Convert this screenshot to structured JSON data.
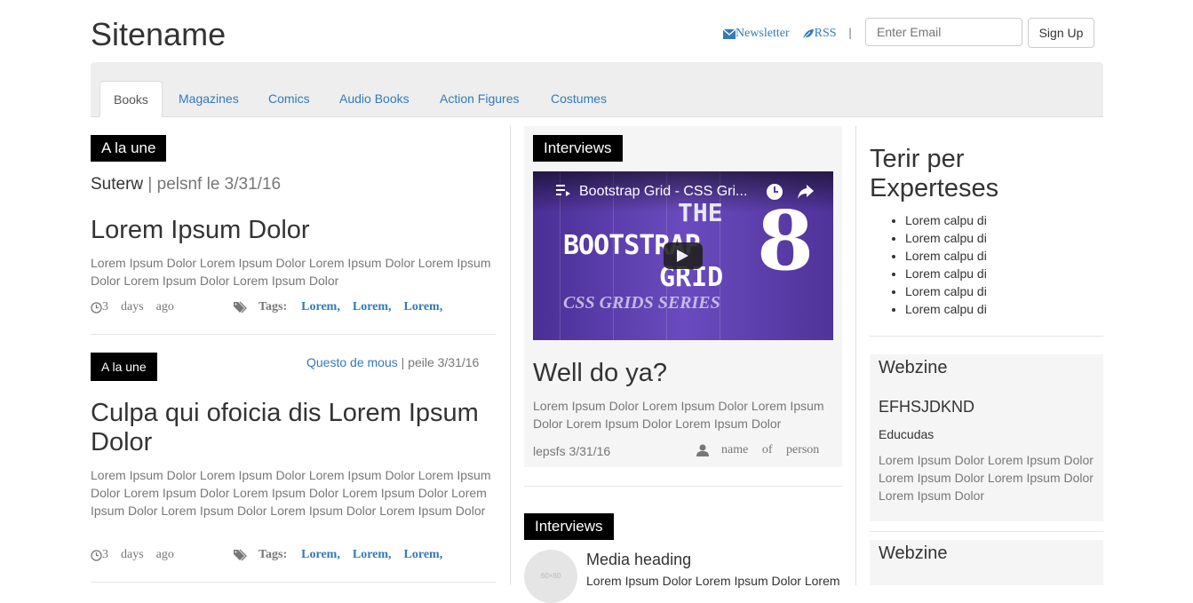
{
  "header": {
    "site_title": "Sitename",
    "newsletter_label": "Newsletter",
    "rss_label": "RSS",
    "separator": "|",
    "email_placeholder": "Enter Email",
    "signup_label": "Sign Up"
  },
  "nav": {
    "tabs": [
      {
        "label": "Books",
        "active": true
      },
      {
        "label": "Magazines"
      },
      {
        "label": "Comics"
      },
      {
        "label": "Audio Books"
      },
      {
        "label": "Action Figures"
      },
      {
        "label": "Costumes"
      }
    ]
  },
  "left": {
    "badge1": "A la une",
    "byline_author": "Suterw",
    "byline_rest": "| pelsnf le 3/31/16",
    "article1": {
      "title": "Lorem Ipsum Dolor",
      "body": "Lorem Ipsum Dolor Lorem Ipsum Dolor Lorem Ipsum Dolor Lorem Ipsum Dolor Lorem Ipsum Dolor Lorem Ipsum Dolor",
      "time_num": "3",
      "time_days": "days",
      "time_ago": "ago",
      "tags_label": "Tags:",
      "tags": [
        "Lorem,",
        "Lorem,",
        "Lorem,"
      ]
    },
    "badge2": "A la une",
    "article2_link": "Questo de mous",
    "article2_meta": "| peile 3/31/16",
    "article2": {
      "title": "Culpa qui ofoicia dis Lorem Ipsum Dolor",
      "body": "Lorem Ipsum Dolor Lorem Ipsum Dolor Lorem Ipsum Dolor Lorem Ipsum Dolor Lorem Ipsum Dolor Lorem Ipsum Dolor Lorem Ipsum Dolor Lorem Ipsum Dolor Lorem Ipsum Dolor Lorem Ipsum Dolor Lorem Ipsum Dolor",
      "time_num": "3",
      "time_days": "days",
      "time_ago": "ago",
      "tags_label": "Tags:",
      "tags": [
        "Lorem,",
        "Lorem,",
        "Lorem,"
      ]
    }
  },
  "middle": {
    "badge1": "Interviews",
    "video": {
      "title": "Bootstrap Grid - CSS Gri...",
      "big_text_1": "THE",
      "big_text_2": "BOOTSTRAP",
      "big_text_3": "GRID",
      "big_number": "8",
      "subtitle": "CSS GRIDS SERIES"
    },
    "feature_title": "Well do ya?",
    "feature_body": "Lorem Ipsum Dolor Lorem Ipsum Dolor Lorem Ipsum Dolor Lorem Ipsum Dolor Lorem Ipsum Dolor",
    "feature_date": "lepsfs 3/31/16",
    "person_name": "name of person",
    "badge2": "Interviews",
    "avatar_text": "60×60",
    "media_heading": "Media heading",
    "media_body": "Lorem Ipsum Dolor Lorem Ipsum Dolor Lorem"
  },
  "right": {
    "heading_line1": "Terir per",
    "heading_line2": "Experteses",
    "list": [
      "Lorem calpu di",
      "Lorem calpu di",
      "Lorem calpu di",
      "Lorem calpu di",
      "Lorem calpu di",
      "Lorem calpu di"
    ],
    "webzine1": {
      "title": "Webzine",
      "subtitle": "EFHSJDKND",
      "label": "Educudas",
      "body": "Lorem Ipsum Dolor Lorem Ipsum Dolor Lorem Ipsum Dolor Lorem Ipsum Dolor Lorem Ipsum Dolor"
    },
    "webzine2": {
      "title": "Webzine"
    }
  },
  "colors": {
    "link": "#337ab7",
    "badge_bg": "#000000",
    "video_purple": "#5b3fa8"
  }
}
